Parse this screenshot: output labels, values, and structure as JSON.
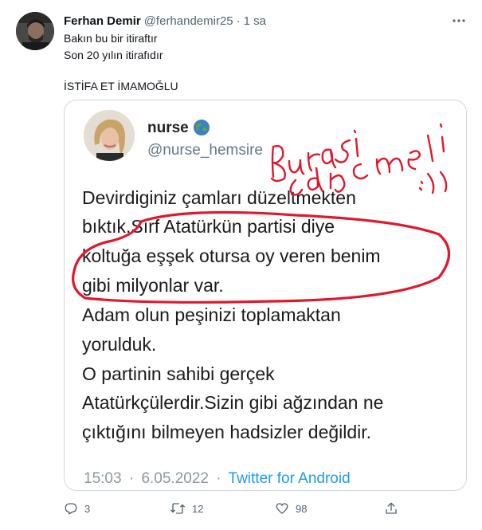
{
  "tweet": {
    "author_name": "Ferhan Demir",
    "author_handle": "@ferhandemir25",
    "separator": "·",
    "time": "1 sa",
    "lines": [
      "Bakın bu bir itiraftır",
      "Son 20 yılın itirafıdır"
    ],
    "headline": "İSTİFA ET İMAMOĞLU"
  },
  "embedded": {
    "name": "nurse",
    "handle": "@nurse_hemsire",
    "body_lines": [
      "Devirdiginiz çamları düzeltmekten",
      "bıktık.Sırf Atatürkün partisi diye",
      "koltuğa eşşek otursa oy veren benim",
      "gibi milyonlar var.",
      "Adam olun peşinizi toplamaktan",
      "yorulduk.",
      "O partinin sahibi gerçek",
      "Atatürkçülerdir.Sizin gibi ağzından ne",
      "çıktığını bilmeyen hadsizler değildir."
    ],
    "time": "15:03",
    "separator": "·",
    "date": "6.05.2022",
    "source": "Twitter for Android"
  },
  "actions": {
    "replies": "3",
    "retweets": "12",
    "likes": "98"
  },
  "icons": {
    "more": "more-horizontal-icon",
    "reply": "reply-icon",
    "retweet": "retweet-icon",
    "like": "heart-icon",
    "share": "share-icon",
    "verified_globe": "globe-icon"
  },
  "colors": {
    "text": "#0f1419",
    "secondary": "#536471",
    "link": "#1d9bf0",
    "border": "#cfd9de",
    "annotation_red": "#e0182d"
  }
}
